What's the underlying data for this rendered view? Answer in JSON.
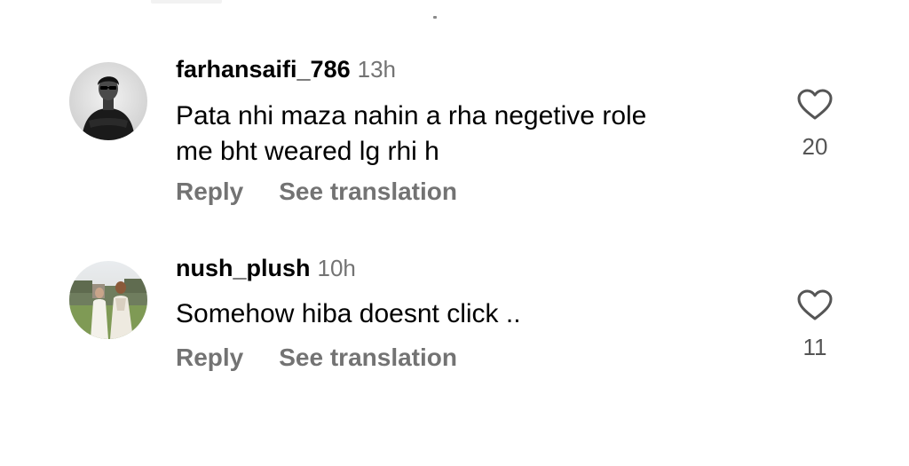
{
  "comments": [
    {
      "username": "farhansaifi_786",
      "time": "13h",
      "text_lines": [
        "Pata nhi maza nahin a rha negetive role",
        "me bht weared lg rhi h"
      ],
      "reply_label": "Reply",
      "translate_label": "See translation",
      "likes": "20",
      "avatar_icon": "profile-photo-man-in-sunglasses"
    },
    {
      "username": "nush_plush",
      "time": "10h",
      "text_lines": [
        "Somehow hiba doesnt click .."
      ],
      "reply_label": "Reply",
      "translate_label": "See translation",
      "likes": "11",
      "avatar_icon": "profile-photo-two-women-outdoors"
    }
  ],
  "like_icon": "heart-outline-icon"
}
